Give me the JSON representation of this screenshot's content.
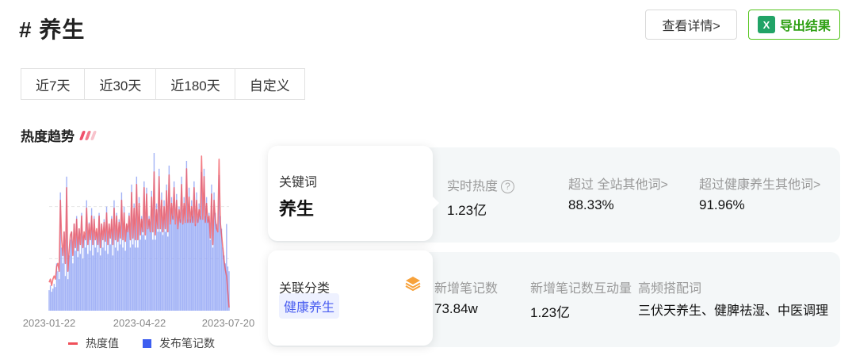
{
  "header": {
    "title": "# 养生",
    "detail_button": "查看详情>",
    "export_button": "导出结果",
    "export_icon_text": "X"
  },
  "range_tabs": [
    {
      "label": "近7天",
      "active": false
    },
    {
      "label": "近30天",
      "active": false
    },
    {
      "label": "近180天",
      "active": true
    },
    {
      "label": "自定义",
      "active": false
    }
  ],
  "trend_section": {
    "title": "热度趋势",
    "accent_color": "#f0506b"
  },
  "chart_data": {
    "type": "bar",
    "x_ticks": [
      "2023-01-22",
      "2023-04-22",
      "2023-07-20"
    ],
    "series": [
      {
        "name": "发布笔记数",
        "kind": "bar",
        "color": "#3d5ef0",
        "values": [
          0.13,
          0.16,
          0.12,
          0.14,
          0.17,
          0.15,
          0.3,
          0.25,
          0.2,
          0.75,
          0.4,
          0.3,
          0.5,
          0.22,
          0.85,
          0.2,
          0.35,
          0.45,
          0.5,
          0.3,
          0.55,
          0.38,
          0.6,
          0.34,
          0.52,
          0.36,
          0.62,
          0.33,
          0.48,
          0.4,
          0.7,
          0.36,
          0.56,
          0.38,
          0.65,
          0.35,
          0.6,
          0.4,
          0.5,
          0.37,
          0.62,
          0.35,
          0.55,
          0.4,
          0.58,
          0.38,
          0.66,
          0.36,
          0.55,
          0.42,
          0.6,
          0.35,
          0.7,
          0.4,
          0.62,
          0.38,
          0.58,
          0.42,
          0.75,
          0.4,
          0.66,
          0.38,
          0.55,
          0.5,
          0.62,
          0.4,
          0.8,
          0.42,
          0.68,
          0.4,
          0.85,
          0.4,
          0.72,
          0.45,
          0.6,
          0.48,
          0.82,
          0.45,
          0.78,
          0.52,
          0.6,
          0.5,
          0.76,
          0.45,
          1.0,
          0.45,
          0.68,
          0.5,
          0.9,
          0.5,
          0.75,
          0.48,
          0.7,
          0.5,
          0.8,
          0.47,
          0.92,
          0.55,
          0.72,
          0.6,
          0.82,
          0.55,
          0.74,
          0.52,
          0.66,
          0.58,
          0.85,
          0.55,
          0.72,
          0.56,
          0.95,
          0.58,
          0.78,
          0.58,
          0.7,
          0.6,
          0.82,
          0.55,
          0.75,
          0.58,
          0.68,
          0.6,
          0.88,
          0.58,
          0.9,
          0.6,
          0.72,
          0.58,
          0.62,
          0.45,
          0.8,
          0.4,
          0.75,
          0.62,
          0.55,
          0.5,
          0.86,
          0.6,
          0.52,
          0.4,
          0.35,
          0.3,
          0.55,
          0.28,
          0.25
        ]
      },
      {
        "name": "热度值",
        "kind": "line",
        "color": "#f0505a",
        "values": [
          0.18,
          0.2,
          0.16,
          0.2,
          0.22,
          0.2,
          0.28,
          0.3,
          0.25,
          0.7,
          0.45,
          0.35,
          0.5,
          0.3,
          0.78,
          0.25,
          0.38,
          0.48,
          0.5,
          0.35,
          0.55,
          0.4,
          0.58,
          0.38,
          0.52,
          0.42,
          0.6,
          0.4,
          0.5,
          0.45,
          0.65,
          0.42,
          0.55,
          0.45,
          0.6,
          0.42,
          0.58,
          0.45,
          0.52,
          0.42,
          0.6,
          0.4,
          0.55,
          0.45,
          0.56,
          0.44,
          0.62,
          0.42,
          0.55,
          0.46,
          0.58,
          0.42,
          0.65,
          0.45,
          0.6,
          0.44,
          0.56,
          0.46,
          0.7,
          0.45,
          0.62,
          0.44,
          0.55,
          0.5,
          0.6,
          0.45,
          0.75,
          0.46,
          0.65,
          0.45,
          0.8,
          0.45,
          0.68,
          0.48,
          0.58,
          0.5,
          0.78,
          0.48,
          0.74,
          0.52,
          0.58,
          0.5,
          0.72,
          0.5,
          0.88,
          0.48,
          0.64,
          0.52,
          0.85,
          0.52,
          0.7,
          0.5,
          0.66,
          0.52,
          0.76,
          0.5,
          0.86,
          0.55,
          0.68,
          0.58,
          0.78,
          0.55,
          0.7,
          0.52,
          0.64,
          0.56,
          0.8,
          0.55,
          0.68,
          0.56,
          0.9,
          0.56,
          0.72,
          0.56,
          0.66,
          0.56,
          0.78,
          0.54,
          0.7,
          0.56,
          0.64,
          0.58,
          0.98,
          0.58,
          0.85,
          0.56,
          0.68,
          0.56,
          0.6,
          0.46,
          0.74,
          0.42,
          0.7,
          0.58,
          0.52,
          0.5,
          0.96,
          0.56,
          0.48,
          0.4,
          0.32,
          0.26,
          0.22,
          0.12,
          0.02
        ]
      }
    ],
    "legend": [
      "热度值",
      "发布笔记数"
    ],
    "legend_position": "bottom",
    "grid": true,
    "ylim": [
      0,
      1
    ]
  },
  "keyword_card": {
    "label": "关键词",
    "value": "养生"
  },
  "row1_metrics": [
    {
      "label": "实时热度",
      "value": "1.23亿",
      "has_help": true
    },
    {
      "label": "超过 全站其他词>",
      "value": "88.33%",
      "has_help": false
    },
    {
      "label": "超过健康养生其他词>",
      "value": "91.96%",
      "has_help": false
    }
  ],
  "category_card": {
    "label": "关联分类",
    "tag": "健康养生",
    "icon": "layers-icon"
  },
  "row2_metrics": [
    {
      "label": "新增笔记数",
      "value": "73.84w"
    },
    {
      "label": "新增笔记数互动量",
      "value": "1.23亿"
    },
    {
      "label": "高频搭配词",
      "value": "三伏天养生、健脾祛湿、中医调理"
    }
  ]
}
